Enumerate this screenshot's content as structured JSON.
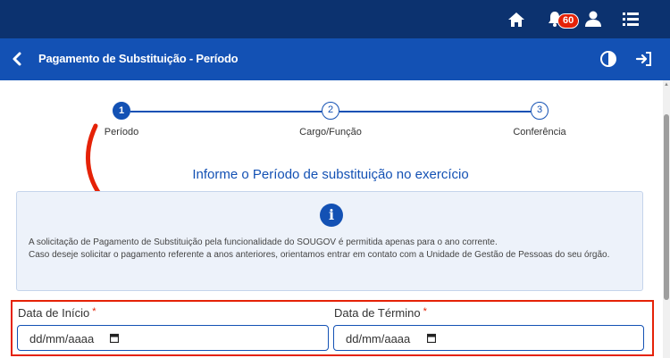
{
  "topbar": {
    "notification_count": "60",
    "icons": [
      "home-icon",
      "bell-icon",
      "user-icon",
      "menu-icon"
    ]
  },
  "header": {
    "title": "Pagamento de Substituição - Período",
    "icons": [
      "back-icon",
      "contrast-icon",
      "logout-icon"
    ]
  },
  "stepper": {
    "steps": [
      {
        "number": "1",
        "label": "Período",
        "active": true
      },
      {
        "number": "2",
        "label": "Cargo/Função",
        "active": false
      },
      {
        "number": "3",
        "label": "Conferência",
        "active": false
      }
    ]
  },
  "main": {
    "heading": "Informe o Período de substituição no exercício",
    "info": {
      "icon": "info-icon",
      "line1": "A solicitação de Pagamento de Substituição pela funcionalidade do SOUGOV é permitida apenas para o ano corrente.",
      "line2": "Caso deseje solicitar o pagamento referente a anos anteriores, orientamos entrar em contato com a Unidade de Gestão de Pessoas do seu órgão."
    },
    "fields": {
      "start": {
        "label": "Data de Início",
        "required": "*",
        "placeholder": "dd/mm/aaaa"
      },
      "end": {
        "label": "Data de Término",
        "required": "*",
        "placeholder": "dd/mm/aaaa"
      }
    }
  },
  "colors": {
    "topbar": "#0c326f",
    "header": "#1351b4",
    "accent": "#1351b4",
    "highlight": "#e52207"
  }
}
